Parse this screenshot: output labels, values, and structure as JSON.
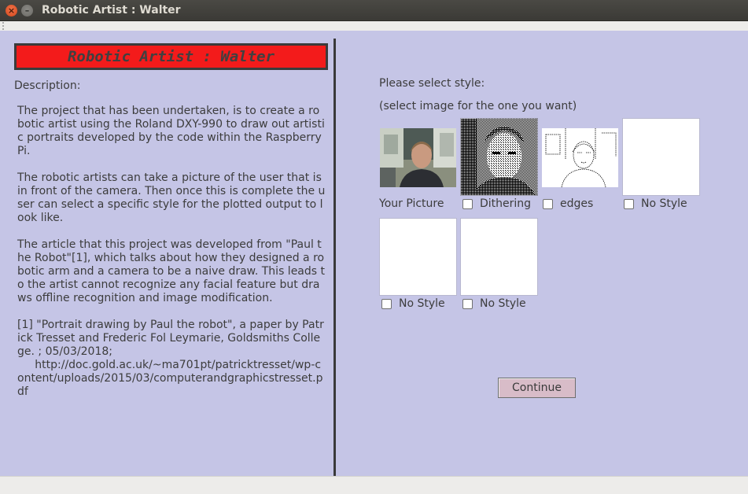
{
  "window": {
    "title": "Robotic Artist : Walter",
    "close_icon": "close-icon",
    "minimize_icon": "minimize-icon"
  },
  "left": {
    "banner": "Robotic Artist : Walter",
    "description_label": "Description:",
    "paragraphs": [
      "The project that has been undertaken, is to create a robotic artist using the Roland DXY-990 to draw out artistic portraits developed by the code within the Raspberry Pi.",
      "The robotic artists can take a picture of the user that is in front of the camera. Then once this is complete the user can select a specific style for the plotted output to look like.",
      "The article that this project was developed from \"Paul the Robot\"[1], which talks about how they designed a robotic arm and a camera to be a naive draw. This leads to the artist cannot recognize any facial feature but draws offline recognition and image modification.",
      "[1] \"Portrait drawing by Paul the robot\", a paper by Patrick Tresset and Frederic Fol Leymarie, Goldsmiths College. ; 05/03/2018;\n     http://doc.gold.ac.uk/~ma701pt/patricktresset/wp-content/uploads/2015/03/computerandgraphicstresset.pdf"
    ]
  },
  "right": {
    "select_label": "Please select style:",
    "select_hint": "(select image for the one you want)",
    "options": [
      {
        "label": "Your Picture",
        "has_checkbox": false,
        "checked": false,
        "image": "webcam photo"
      },
      {
        "label": "Dithering",
        "has_checkbox": true,
        "checked": false,
        "image": "dithered portrait"
      },
      {
        "label": "edges",
        "has_checkbox": true,
        "checked": false,
        "image": "edge-detected portrait"
      },
      {
        "label": "No Style",
        "has_checkbox": true,
        "checked": false,
        "image": "blank"
      },
      {
        "label": "No Style",
        "has_checkbox": true,
        "checked": false,
        "image": "blank"
      },
      {
        "label": "No Style",
        "has_checkbox": true,
        "checked": false,
        "image": "blank"
      }
    ],
    "continue_label": "Continue"
  }
}
